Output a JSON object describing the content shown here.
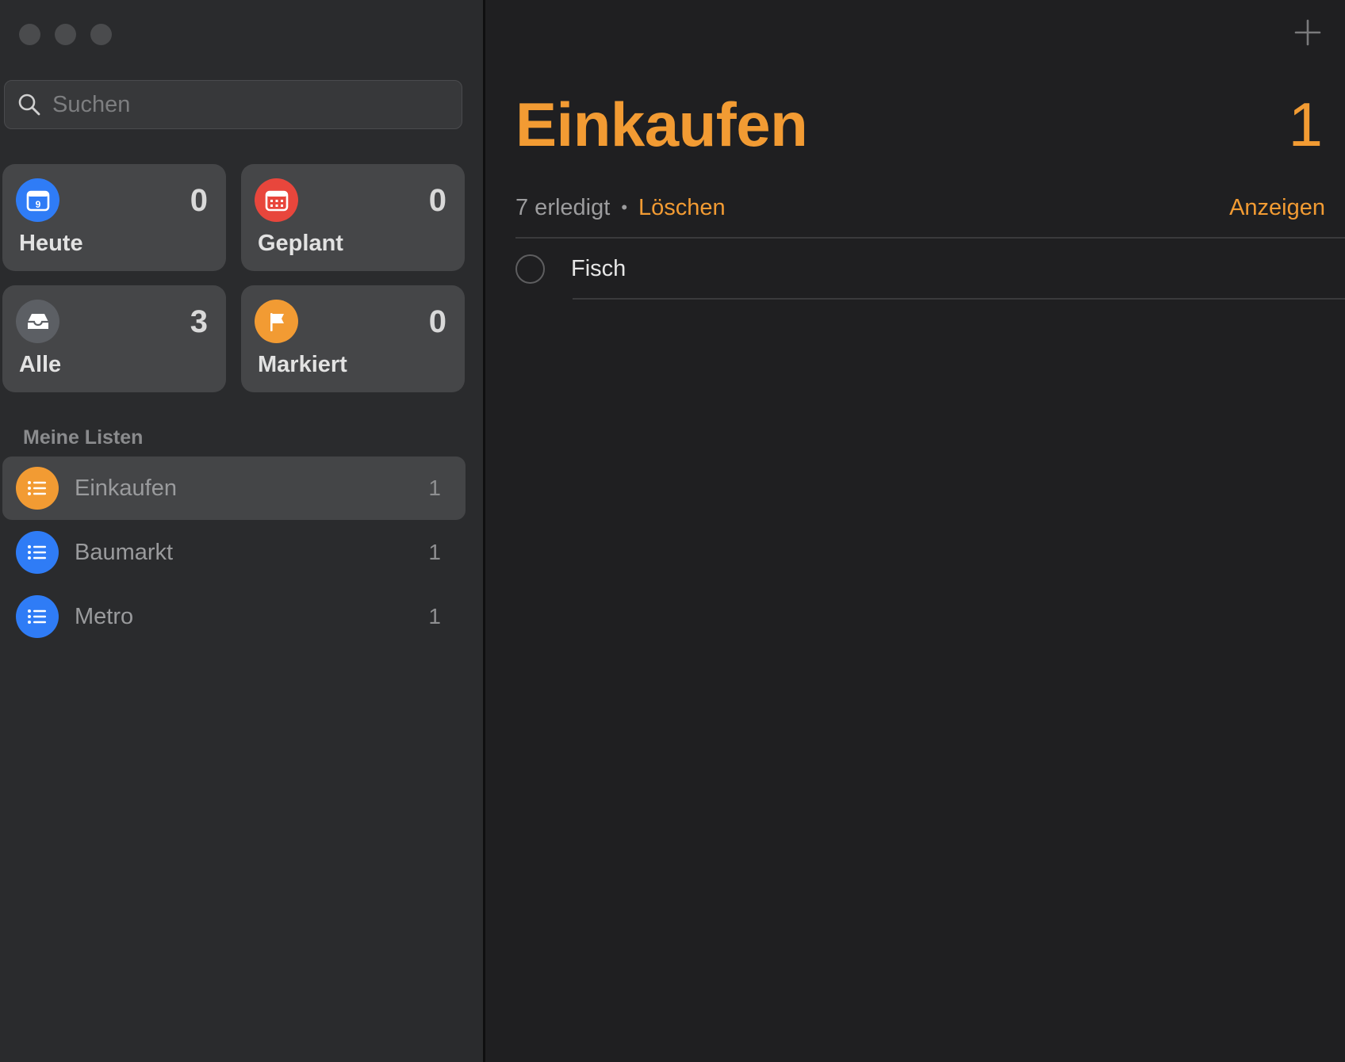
{
  "sidebar": {
    "search": {
      "placeholder": "Suchen",
      "value": ""
    },
    "smart_lists": [
      {
        "label": "Heute",
        "count": "0",
        "icon": "calendar-today-icon",
        "color": "#2f7cf6"
      },
      {
        "label": "Geplant",
        "count": "0",
        "icon": "calendar-grid-icon",
        "color": "#e8463c"
      },
      {
        "label": "Alle",
        "count": "3",
        "icon": "inbox-tray-icon",
        "color": "#5c5f64"
      },
      {
        "label": "Markiert",
        "count": "0",
        "icon": "flag-icon",
        "color": "#f29b33"
      }
    ],
    "section_title": "Meine Listen",
    "lists": [
      {
        "name": "Einkaufen",
        "count": "1",
        "color": "#f29b33",
        "selected": true
      },
      {
        "name": "Baumarkt",
        "count": "1",
        "color": "#2f7cf6",
        "selected": false
      },
      {
        "name": "Metro",
        "count": "1",
        "color": "#2f7cf6",
        "selected": false
      }
    ]
  },
  "main": {
    "title": "Einkaufen",
    "total": "1",
    "completed_text": "7 erledigt",
    "clear_label": "Löschen",
    "show_label": "Anzeigen",
    "tasks": [
      {
        "title": "Fisch",
        "done": false
      }
    ]
  },
  "colors": {
    "accent": "#f29b33",
    "blue": "#2f7cf6",
    "red": "#e8463c"
  }
}
